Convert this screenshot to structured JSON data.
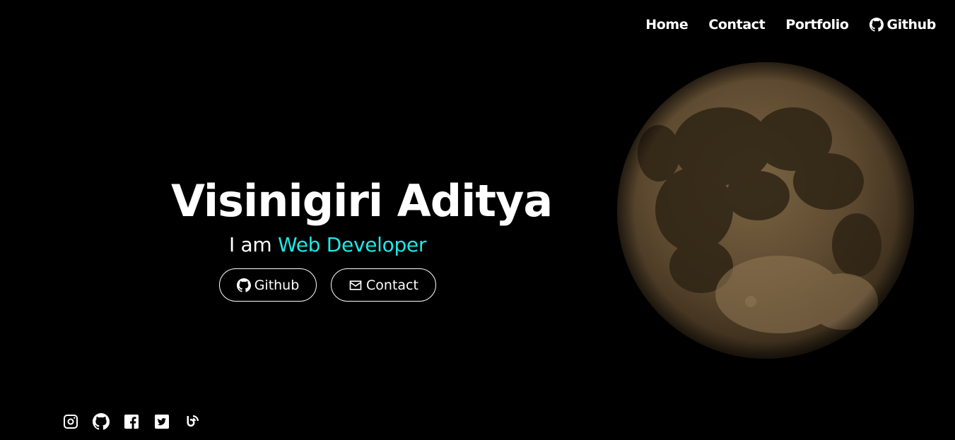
{
  "nav": {
    "items": [
      {
        "label": "Home"
      },
      {
        "label": "Contact"
      },
      {
        "label": "Portfolio"
      },
      {
        "label": "Github",
        "icon": "github-icon"
      }
    ]
  },
  "hero": {
    "name": "Visinigiri Aditya",
    "tagline_prefix": "I am",
    "tagline_role": "Web Developer",
    "role_color": "#1de9e6",
    "buttons": [
      {
        "label": "Github",
        "icon": "github-icon"
      },
      {
        "label": "Contact",
        "icon": "envelope-icon"
      }
    ]
  },
  "image": {
    "subject": "moon"
  },
  "social": [
    "instagram-icon",
    "github-icon",
    "facebook-icon",
    "twitter-icon",
    "blog-icon"
  ]
}
